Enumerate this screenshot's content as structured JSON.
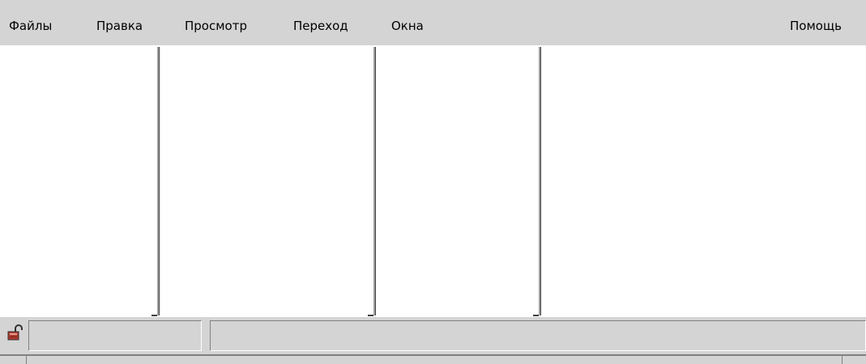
{
  "menu": {
    "items": [
      "Файлы",
      "Правка",
      "Просмотр",
      "Переход",
      "Окна"
    ],
    "help": "Помощь"
  },
  "statusbar": {
    "lock_icon": "unlocked-padlock-icon",
    "panel_1": "",
    "panel_2": ""
  },
  "colors": {
    "chrome": "#d4d4d4",
    "content_background": "#ffffff",
    "lock_icon_body": "#b03a2e"
  }
}
